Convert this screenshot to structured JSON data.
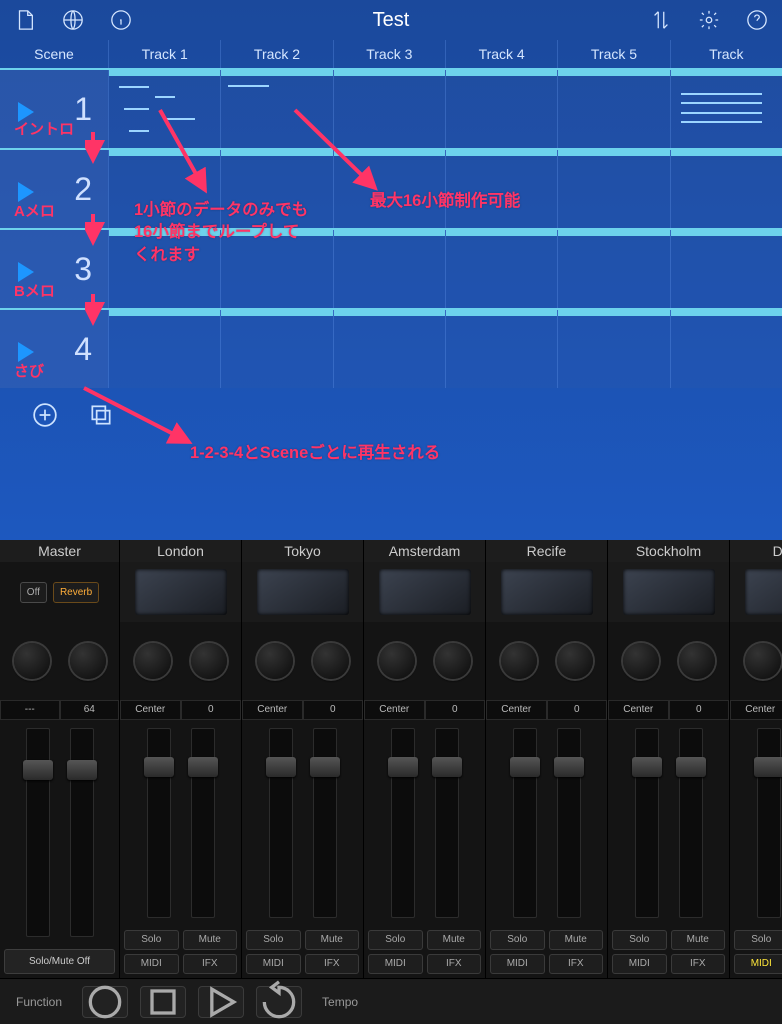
{
  "project_title": "Test",
  "scene_header": "Scene",
  "tracks": [
    "Track 1",
    "Track 2",
    "Track 3",
    "Track 4",
    "Track 5",
    "Track"
  ],
  "scenes": [
    {
      "num": "1",
      "tag": "イントロ"
    },
    {
      "num": "2",
      "tag": "Aメロ"
    },
    {
      "num": "3",
      "tag": "Bメロ"
    },
    {
      "num": "4",
      "tag": "さび"
    }
  ],
  "annotations": {
    "loop": "1小節のデータのみでも\n16小節までループして\nくれます",
    "max": "最大16小節制作可能",
    "order": "1-2-3-4とSceneごとに再生される"
  },
  "mixer": {
    "master": {
      "name": "Master",
      "off": "Off",
      "reverb": "Reverb",
      "val_left": "---",
      "val_right": "64",
      "solo_off": "Solo/Mute Off"
    },
    "channels": [
      {
        "name": "London",
        "pan": "Center",
        "val": "0",
        "solo": "Solo",
        "mute": "Mute",
        "midi": "MIDI",
        "ifx": "IFX"
      },
      {
        "name": "Tokyo",
        "pan": "Center",
        "val": "0",
        "solo": "Solo",
        "mute": "Mute",
        "midi": "MIDI",
        "ifx": "IFX"
      },
      {
        "name": "Amsterdam",
        "pan": "Center",
        "val": "0",
        "solo": "Solo",
        "mute": "Mute",
        "midi": "MIDI",
        "ifx": "IFX"
      },
      {
        "name": "Recife",
        "pan": "Center",
        "val": "0",
        "solo": "Solo",
        "mute": "Mute",
        "midi": "MIDI",
        "ifx": "IFX"
      },
      {
        "name": "Stockholm",
        "pan": "Center",
        "val": "0",
        "solo": "Solo",
        "mute": "Mute",
        "midi": "MIDI",
        "ifx": "IFX"
      },
      {
        "name": "Darwi",
        "pan": "Center",
        "val": "",
        "solo": "Solo",
        "mute": "",
        "midi": "MIDI",
        "ifx": "",
        "midi_on": true
      }
    ]
  },
  "transport": {
    "function": "Function",
    "tempo": "Tempo"
  }
}
